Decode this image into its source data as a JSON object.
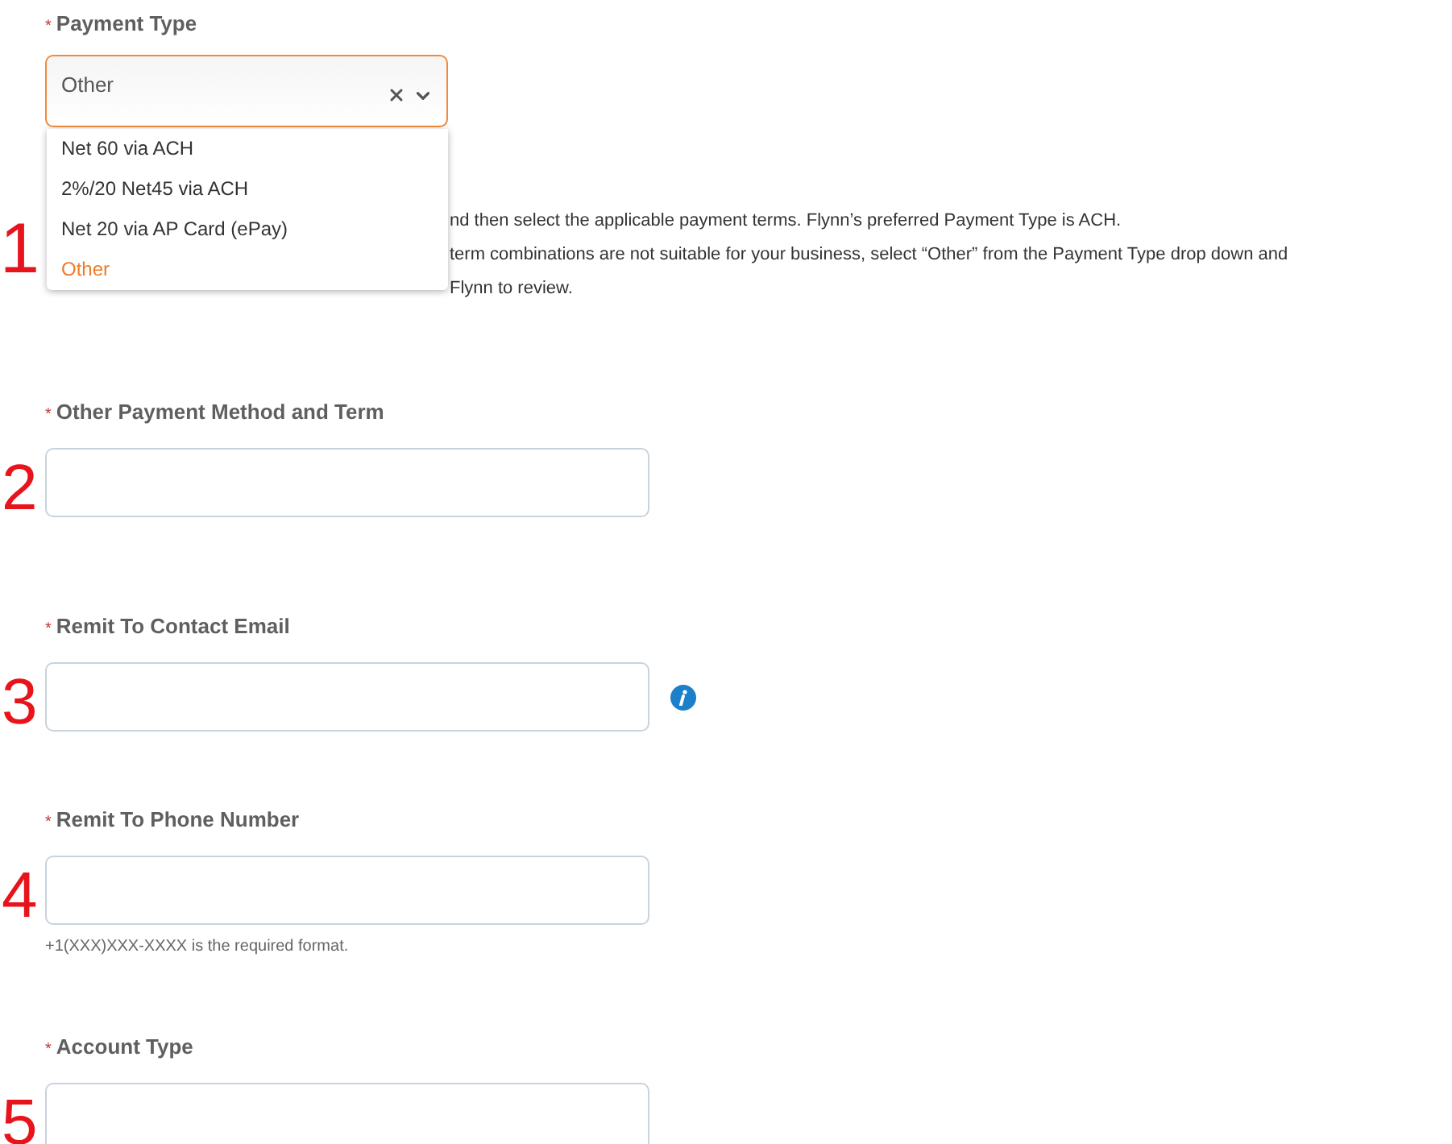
{
  "fields": [
    {
      "kind": "select",
      "required_mark": "*",
      "label": "Payment Type",
      "value": "Other",
      "marker": "1",
      "menu": [
        {
          "label": "Net 60 via ACH",
          "selected": false
        },
        {
          "label": "2%/20 Net45 via ACH",
          "selected": false
        },
        {
          "label": "Net 20 via AP Card (ePay)",
          "selected": false
        },
        {
          "label": "Other",
          "selected": true
        }
      ],
      "help_lines": [
        "nd then select the applicable payment terms. Flynn’s preferred Payment Type is ACH.",
        "term combinations are not suitable for your business, select “Other” from the Payment Type drop down and",
        "Flynn to review."
      ]
    },
    {
      "kind": "text",
      "required_mark": "*",
      "label": "Other Payment Method and Term",
      "marker": "2"
    },
    {
      "kind": "text",
      "required_mark": "*",
      "label": "Remit To Contact Email",
      "marker": "3",
      "info": true
    },
    {
      "kind": "text",
      "required_mark": "*",
      "label": "Remit To Phone Number",
      "marker": "4",
      "hint": "+1(XXX)XXX-XXXX is the required format."
    },
    {
      "kind": "text",
      "required_mark": "*",
      "label": "Account Type",
      "marker": "5"
    }
  ]
}
